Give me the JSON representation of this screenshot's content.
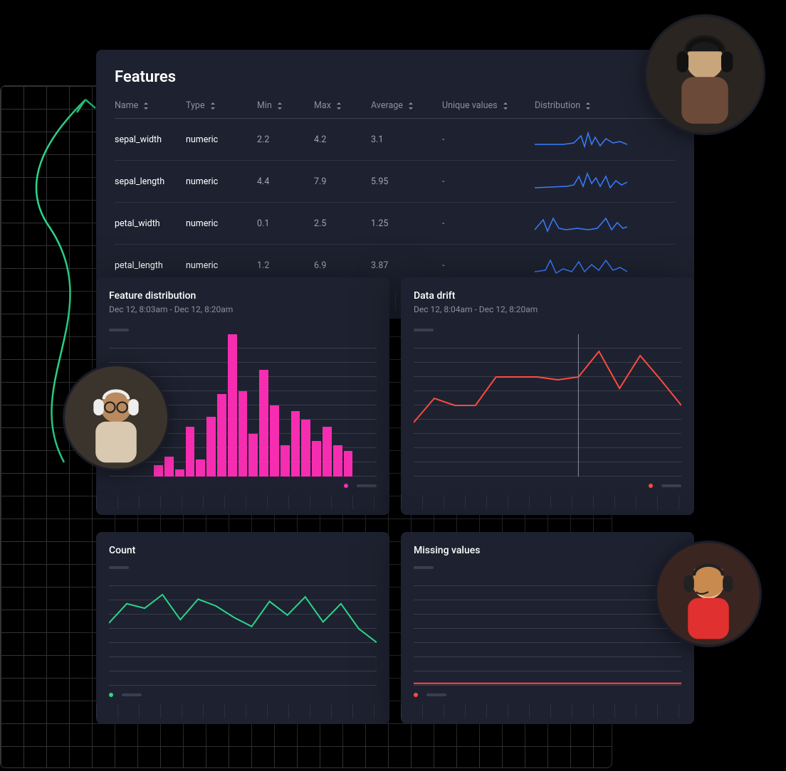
{
  "panel": {
    "title": "Features",
    "columns": [
      "Name",
      "Type",
      "Min",
      "Max",
      "Average",
      "Unique values",
      "Distribution"
    ],
    "rows": [
      {
        "name": "sepal_width",
        "type": "numeric",
        "min": "2.2",
        "max": "4.2",
        "avg": "3.1",
        "unique": "-"
      },
      {
        "name": "sepal_length",
        "type": "numeric",
        "min": "4.4",
        "max": "7.9",
        "avg": "5.95",
        "unique": "-"
      },
      {
        "name": "petal_width",
        "type": "numeric",
        "min": "0.1",
        "max": "2.5",
        "avg": "1.25",
        "unique": "-"
      },
      {
        "name": "petal_length",
        "type": "numeric",
        "min": "1.2",
        "max": "6.9",
        "avg": "3.87",
        "unique": "-"
      }
    ]
  },
  "feature_distribution": {
    "title": "Feature distribution",
    "subtitle": "Dec 12, 8:03am - Dec 12, 8:20am"
  },
  "data_drift": {
    "title": "Data drift",
    "subtitle": "Dec 12, 8:04am - Dec 12, 8:20am"
  },
  "count": {
    "title": "Count"
  },
  "missing": {
    "title": "Missing values"
  },
  "colors": {
    "pink": "#f72db1",
    "red": "#ff4b3e",
    "green": "#2bd689",
    "blue": "#3a7cff"
  },
  "chart_data": [
    {
      "type": "bar",
      "title": "Feature distribution",
      "subtitle": "Dec 12, 8:03am - Dec 12, 8:20am",
      "values": [
        0,
        0,
        0,
        0,
        8,
        14,
        5,
        35,
        12,
        42,
        58,
        100,
        60,
        30,
        75,
        50,
        22,
        46,
        40,
        25,
        35,
        22,
        18,
        0,
        0
      ],
      "ylim": [
        0,
        100
      ],
      "color": "#f72db1"
    },
    {
      "type": "line",
      "title": "Data drift",
      "subtitle": "Dec 12, 8:04am - Dec 12, 8:20am",
      "x": [
        0,
        1,
        2,
        3,
        4,
        5,
        6,
        7,
        8,
        9,
        10,
        11,
        12,
        13
      ],
      "values": [
        0.38,
        0.55,
        0.5,
        0.5,
        0.7,
        0.7,
        0.7,
        0.68,
        0.7,
        0.88,
        0.62,
        0.85,
        0.68,
        0.5
      ],
      "marker_x": 8,
      "ylim": [
        0,
        1
      ],
      "color": "#ff4b3e"
    },
    {
      "type": "line",
      "title": "Count",
      "x": [
        0,
        1,
        2,
        3,
        4,
        5,
        6,
        7,
        8,
        9,
        10,
        11,
        12,
        13,
        14,
        15
      ],
      "values": [
        0.55,
        0.72,
        0.68,
        0.8,
        0.58,
        0.76,
        0.7,
        0.6,
        0.52,
        0.74,
        0.62,
        0.78,
        0.56,
        0.72,
        0.5,
        0.38
      ],
      "ylim": [
        0,
        1
      ],
      "color": "#2bd689"
    },
    {
      "type": "line",
      "title": "Missing values",
      "x": [
        0,
        1
      ],
      "values": [
        0.02,
        0.02
      ],
      "ylim": [
        0,
        1
      ],
      "color": "#ff4b3e"
    }
  ]
}
